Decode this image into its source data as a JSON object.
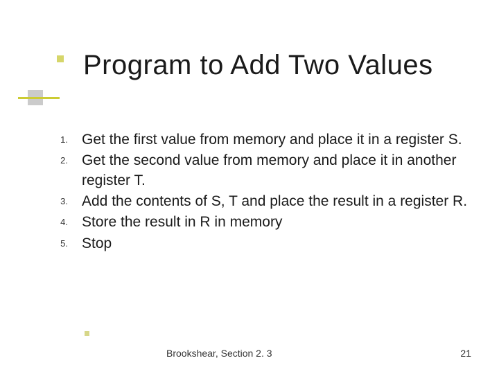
{
  "title": "Program to Add Two Values",
  "items": [
    {
      "n": "1.",
      "t": "Get the first value from memory and place it in a register S."
    },
    {
      "n": "2.",
      "t": "Get the second value from memory and place it in another register T."
    },
    {
      "n": "3.",
      "t": "Add the contents of S, T and place the result in a register R."
    },
    {
      "n": "4.",
      "t": "Store the result in R in memory"
    },
    {
      "n": "5.",
      "t": "Stop"
    }
  ],
  "footer": {
    "ref": "Brookshear, Section 2. 3",
    "page": "21"
  }
}
